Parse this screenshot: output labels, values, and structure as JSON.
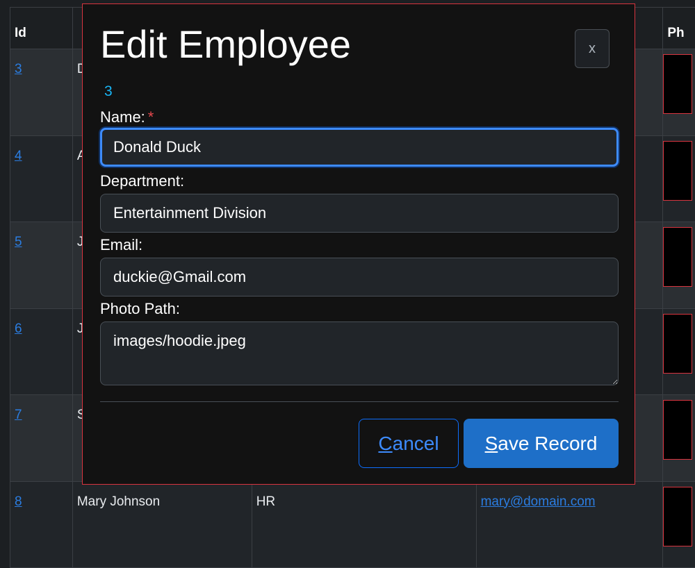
{
  "table": {
    "headers": [
      "Id",
      "Ph"
    ],
    "rows": [
      {
        "id": "3",
        "name": "D"
      },
      {
        "id": "4",
        "name": "A"
      },
      {
        "id": "5",
        "name": "J"
      },
      {
        "id": "6",
        "name": "J"
      },
      {
        "id": "7",
        "name": "S"
      },
      {
        "id": "8",
        "name": "Mary Johnson",
        "department": "HR",
        "email": "mary@domain.com"
      }
    ]
  },
  "modal": {
    "title": "Edit Employee",
    "close_label": "x",
    "record_id": "3",
    "name_label": "Name:",
    "required_marker": "*",
    "name_value": "Donald Duck",
    "department_label": "Department:",
    "department_value": "Entertainment Division",
    "email_label": "Email:",
    "email_value": "duckie@Gmail.com",
    "photo_label": "Photo Path:",
    "photo_value": "images/hoodie.jpeg",
    "cancel_label": "Cancel",
    "save_label": "Save Record"
  },
  "colors": {
    "accent": "#1e6fc8",
    "danger": "#d9343f",
    "id_text": "#19b5f5"
  }
}
